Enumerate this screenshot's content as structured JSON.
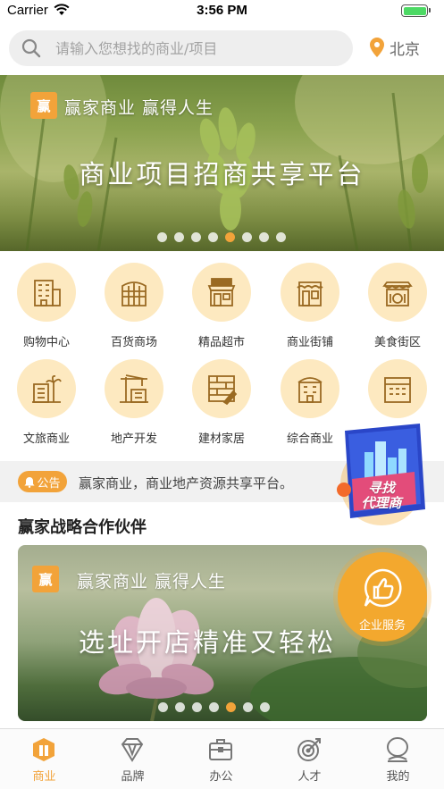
{
  "status_bar": {
    "carrier": "Carrier",
    "time": "3:56 PM"
  },
  "search": {
    "placeholder": "请输入您想找的商业/项目",
    "location": "北京"
  },
  "banner": {
    "logo_char": "赢",
    "slogan": "赢家商业  赢得人生",
    "title": "商业项目招商共享平台",
    "dot_count": 8,
    "active_dot": 4
  },
  "categories": [
    {
      "label": "购物中心",
      "icon": "shopping-mall-icon"
    },
    {
      "label": "百货商场",
      "icon": "department-store-icon"
    },
    {
      "label": "精品超市",
      "icon": "supermarket-icon"
    },
    {
      "label": "商业街铺",
      "icon": "street-shop-icon"
    },
    {
      "label": "美食街区",
      "icon": "food-street-icon"
    },
    {
      "label": "文旅商业",
      "icon": "cultural-tourism-icon"
    },
    {
      "label": "地产开发",
      "icon": "real-estate-crane-icon"
    },
    {
      "label": "建材家居",
      "icon": "building-materials-icon"
    },
    {
      "label": "综合商业",
      "icon": "complex-commercial-icon"
    },
    {
      "label": "",
      "icon": "building-icon"
    }
  ],
  "notice": {
    "badge": "公告",
    "text": "赢家商业，商业地产资源共享平台。"
  },
  "partners": {
    "section_title": "赢家战略合作伙伴",
    "card": {
      "logo_char": "赢",
      "slogan": "赢家商业  赢得人生",
      "title": "选址开店精准又轻松",
      "dot_count": 7,
      "active_dot": 4
    }
  },
  "float_agent": {
    "label_line1": "寻找",
    "label_line2": "代理商"
  },
  "float_service": {
    "label": "企业服务"
  },
  "tabs": [
    {
      "label": "商业",
      "icon": "business-tab-icon",
      "active": true
    },
    {
      "label": "品牌",
      "icon": "diamond-brand-icon",
      "active": false
    },
    {
      "label": "办公",
      "icon": "briefcase-office-icon",
      "active": false
    },
    {
      "label": "人才",
      "icon": "target-talent-icon",
      "active": false
    },
    {
      "label": "我的",
      "icon": "profile-icon",
      "active": false
    }
  ],
  "colors": {
    "accent": "#f2a33a",
    "icon_bg": "#fde9c0",
    "icon_stroke": "#9a6a22",
    "notice_bg": "#f1f1f1"
  }
}
